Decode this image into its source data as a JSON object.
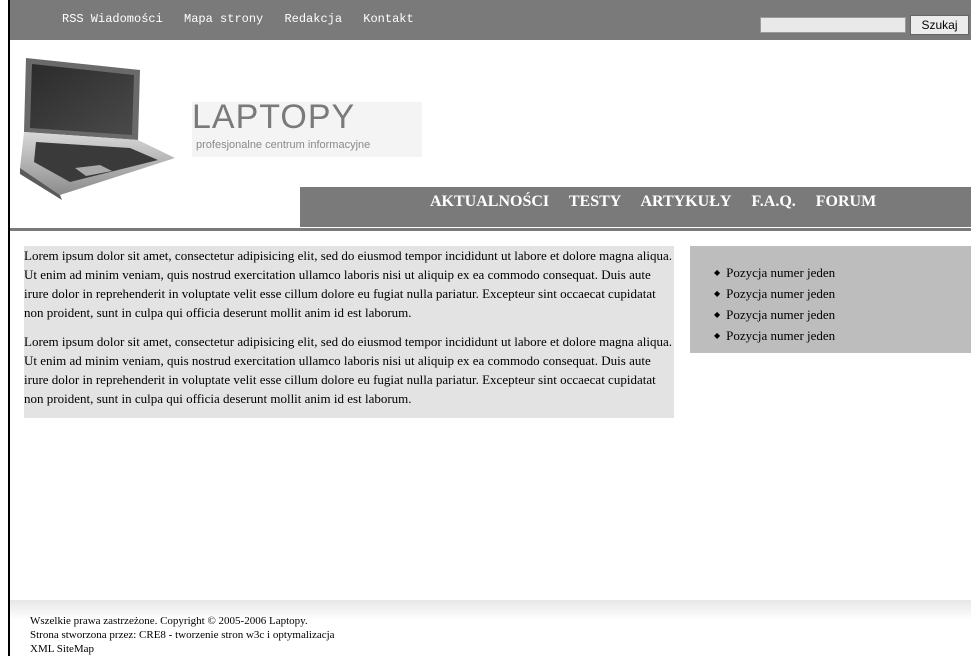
{
  "topbar": {
    "links": [
      "RSS Wiadomości",
      "Mapa strony",
      "Redakcja",
      "Kontakt"
    ],
    "search_placeholder": "",
    "search_button": "Szukaj"
  },
  "header": {
    "logo_title": "LAPTOPY",
    "logo_subtitle": "profesjonalne centrum informacyjne",
    "nav": [
      "AKTUALNOŚCI",
      "TESTY",
      "ARTYKUŁY",
      "F.A.Q.",
      "FORUM"
    ]
  },
  "content": {
    "paragraphs": [
      "Lorem ipsum dolor sit amet, consectetur adipisicing elit, sed do eiusmod tempor incididunt ut labore et dolore magna aliqua. Ut enim ad minim veniam, quis nostrud exercitation ullamco laboris nisi ut aliquip ex ea commodo consequat. Duis aute irure dolor in reprehenderit in voluptate velit esse cillum dolore eu fugiat nulla pariatur. Excepteur sint occaecat cupidatat non proident, sunt in culpa qui officia deserunt mollit anim id est laborum.",
      "Lorem ipsum dolor sit amet, consectetur adipisicing elit, sed do eiusmod tempor incididunt ut labore et dolore magna aliqua. Ut enim ad minim veniam, quis nostrud exercitation ullamco laboris nisi ut aliquip ex ea commodo consequat. Duis aute irure dolor in reprehenderit in voluptate velit esse cillum dolore eu fugiat nulla pariatur. Excepteur sint occaecat cupidatat non proident, sunt in culpa qui officia deserunt mollit anim id est laborum."
    ]
  },
  "sidebar": {
    "items": [
      "Pozycja numer jeden",
      "Pozycja numer jeden",
      "Pozycja numer jeden",
      "Pozycja numer jeden"
    ]
  },
  "footer": {
    "lines": [
      "Wszelkie prawa zastrzeżone. Copyright © 2005-2006 Laptopy.",
      "Strona stworzona przez: CRE8 - tworzenie stron w3c i optymalizacja",
      "XML SiteMap"
    ]
  },
  "colors": {
    "bar": "#7a7a7a",
    "content_bg": "#e3e3e3",
    "sidebar_bg": "#bdbdbd"
  },
  "icons": [
    "laptop-icon"
  ]
}
